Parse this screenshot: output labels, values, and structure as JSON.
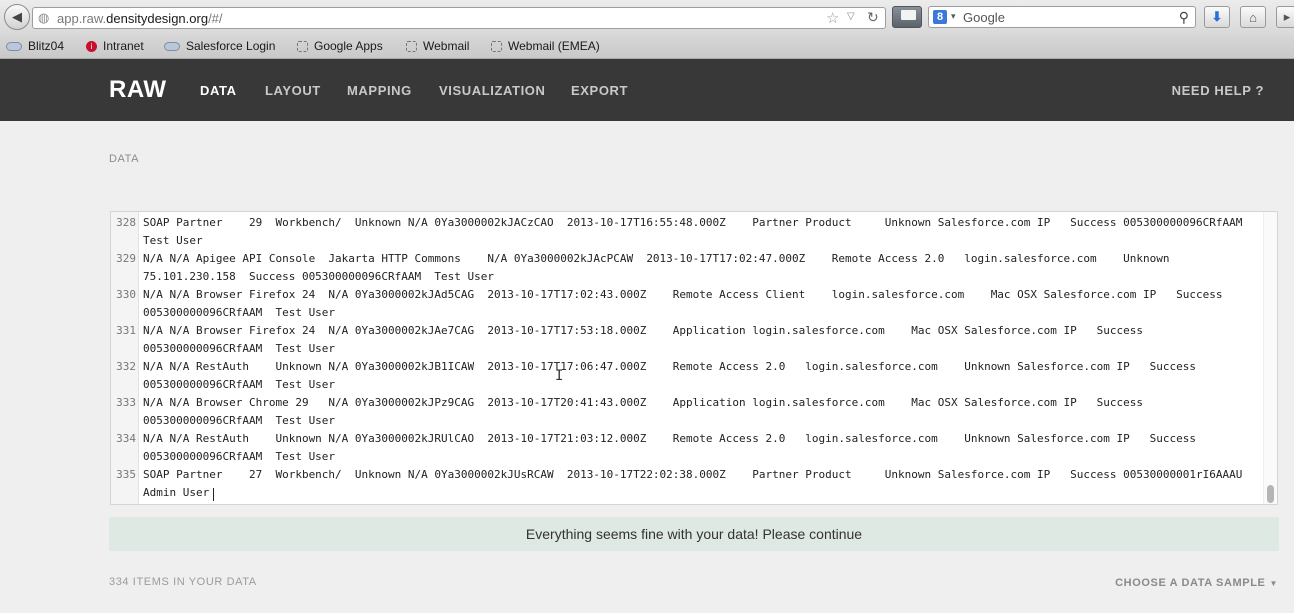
{
  "browser": {
    "url_prefix": "app.raw.",
    "url_domain": "densitydesign.org",
    "url_suffix": "/#/",
    "search_placeholder": "Google",
    "search_engine_glyph": "8",
    "bookmarks": [
      {
        "label": "Blitz04",
        "icon": "cloud-icon"
      },
      {
        "label": "Intranet",
        "icon": "info-icon"
      },
      {
        "label": "Salesforce Login",
        "icon": "cloud-icon"
      },
      {
        "label": "Google Apps",
        "icon": "bookmark-icon"
      },
      {
        "label": "Webmail",
        "icon": "bookmark-icon"
      },
      {
        "label": "Webmail (EMEA)",
        "icon": "bookmark-icon"
      }
    ]
  },
  "nav": {
    "logo": "RAW",
    "items": [
      "DATA",
      "LAYOUT",
      "MAPPING",
      "VISUALIZATION",
      "EXPORT"
    ],
    "active": "DATA",
    "help": "NEED HELP ?"
  },
  "data_section": {
    "label": "DATA",
    "lines": [
      {
        "num": "328",
        "text": "SOAP Partner    29  Workbench/  Unknown N/A 0Ya3000002kJACzCAO  2013-10-17T16:55:48.000Z    Partner Product     Unknown Salesforce.com IP   Success 005300000096CRfAAM  Test User"
      },
      {
        "num": "329",
        "text": "N/A N/A Apigee API Console  Jakarta HTTP Commons    N/A 0Ya3000002kJAcPCAW  2013-10-17T17:02:47.000Z    Remote Access 2.0   login.salesforce.com    Unknown 75.101.230.158  Success 005300000096CRfAAM  Test User"
      },
      {
        "num": "330",
        "text": "N/A N/A Browser Firefox 24  N/A 0Ya3000002kJAd5CAG  2013-10-17T17:02:43.000Z    Remote Access Client    login.salesforce.com    Mac OSX Salesforce.com IP   Success 005300000096CRfAAM  Test User"
      },
      {
        "num": "331",
        "text": "N/A N/A Browser Firefox 24  N/A 0Ya3000002kJAe7CAG  2013-10-17T17:53:18.000Z    Application login.salesforce.com    Mac OSX Salesforce.com IP   Success 005300000096CRfAAM  Test User"
      },
      {
        "num": "332",
        "text": "N/A N/A RestAuth    Unknown N/A 0Ya3000002kJB1ICAW  2013-10-17T17:06:47.000Z    Remote Access 2.0   login.salesforce.com    Unknown Salesforce.com IP   Success 005300000096CRfAAM  Test User"
      },
      {
        "num": "333",
        "text": "N/A N/A Browser Chrome 29   N/A 0Ya3000002kJPz9CAG  2013-10-17T20:41:43.000Z    Application login.salesforce.com    Mac OSX Salesforce.com IP   Success 005300000096CRfAAM  Test User"
      },
      {
        "num": "334",
        "text": "N/A N/A RestAuth    Unknown N/A 0Ya3000002kJRUlCAO  2013-10-17T21:03:12.000Z    Remote Access 2.0   login.salesforce.com    Unknown Salesforce.com IP   Success 005300000096CRfAAM  Test User"
      },
      {
        "num": "335",
        "text": "SOAP Partner    27  Workbench/  Unknown N/A 0Ya3000002kJUsRCAW  2013-10-17T22:02:38.000Z    Partner Product     Unknown Salesforce.com IP   Success 00530000001rI6AAAU  Admin User"
      }
    ],
    "status_message": "Everything seems fine with your data! Please continue",
    "item_count": "334 ITEMS IN YOUR DATA",
    "sample_select": "CHOOSE A DATA SAMPLE"
  },
  "colors": {
    "nav_bg": "#383838",
    "status_bg": "#dfe9e4",
    "page_bg": "#efefef"
  }
}
